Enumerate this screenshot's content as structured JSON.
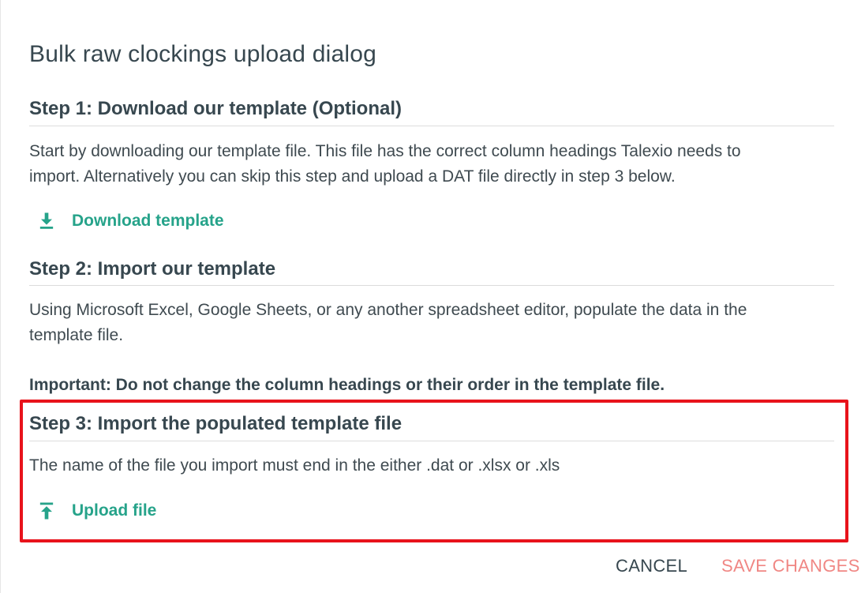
{
  "dialog": {
    "title": "Bulk raw clockings upload dialog"
  },
  "step1": {
    "heading": "Step 1: Download our template (Optional)",
    "line1": "Start by downloading our template file. This file has the correct column headings Talexio needs to",
    "line2": "import. Alternatively you can skip this step and upload a DAT file directly in step 3 below.",
    "action_label": "Download template",
    "action_icon": "download-icon"
  },
  "step2": {
    "heading": "Step 2: Import our template",
    "line1": "Using Microsoft Excel, Google Sheets, or any another spreadsheet editor, populate the data in the",
    "line2": "template file.",
    "important": "Important: Do not change the column headings or their order in the template file."
  },
  "step3": {
    "heading": "Step 3: Import the populated template file",
    "description": "The name of the file you import must end in the either .dat or .xlsx or .xls",
    "action_label": "Upload file",
    "action_icon": "upload-icon"
  },
  "footer": {
    "cancel_label": "CANCEL",
    "save_label": "SAVE CHANGES"
  },
  "colors": {
    "accent": "#26a38a",
    "save_disabled": "#f08784",
    "highlight_border": "#e8131b",
    "text": "#37474f"
  }
}
